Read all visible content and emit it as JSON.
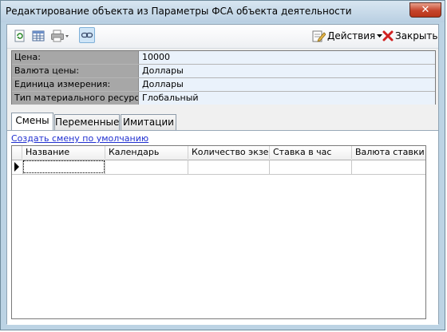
{
  "window": {
    "title": "Редактирование объекта из Параметры ФСА объекта деятельности",
    "close_glyph": "✕"
  },
  "toolbar": {
    "icons": [
      "refresh-icon",
      "table-icon",
      "print-icon",
      "link-icon"
    ],
    "actions_label": "Действия",
    "close_label": "Закрыть"
  },
  "properties": [
    {
      "label": "Цена:",
      "value": "10000"
    },
    {
      "label": "Валюта цены:",
      "value": "Доллары"
    },
    {
      "label": "Единица измерения:",
      "value": "Доллары"
    },
    {
      "label": "Тип материального ресурса:",
      "value": "Глобальный"
    }
  ],
  "tabs": [
    "Смены",
    "Переменные",
    "Имитации"
  ],
  "active_tab": "Смены",
  "panel": {
    "create_link": "Создать смену по умолчанию",
    "grid": {
      "columns": [
        "Название",
        "Календарь",
        "Количество экзе...",
        "Ставка в час",
        "Валюта ставки"
      ],
      "rows": [
        [
          "",
          "",
          "",
          "",
          ""
        ]
      ]
    }
  }
}
